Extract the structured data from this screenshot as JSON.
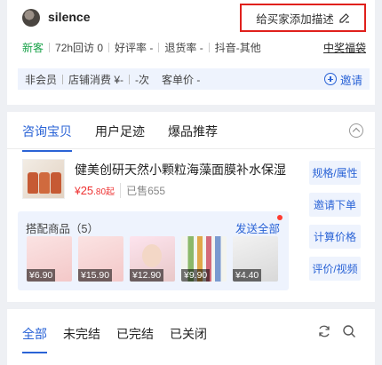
{
  "header": {
    "username": "silence",
    "add_note": "给买家添加描述",
    "stats": [
      "新客",
      "72h回访 0",
      "好评率 -",
      "退货率 -",
      "抖音-其他"
    ],
    "prize_link": "中奖福袋",
    "tags": [
      "非会员",
      "店铺消费 ¥-",
      "-次",
      "客单价 -"
    ],
    "invite": "邀请"
  },
  "consult": {
    "tabs": [
      "咨询宝贝",
      "用户足迹",
      "爆品推荐"
    ],
    "product": {
      "title": "健美创研天然小颗粒海藻面膜补水保湿",
      "price_symbol": "¥",
      "price_int": "25",
      "price_dec": ".80起",
      "sold": "已售655"
    },
    "match": {
      "title": "搭配商品（5）",
      "send_all": "发送全部",
      "items": [
        {
          "price": "¥6.90"
        },
        {
          "price": "¥15.90"
        },
        {
          "price": "¥12.90"
        },
        {
          "price": "¥9.90"
        },
        {
          "price": "¥4.40"
        }
      ]
    },
    "side_buttons": [
      "规格/属性",
      "邀请下单",
      "计算价格",
      "评价/视频"
    ]
  },
  "filters": {
    "tabs": [
      "全部",
      "未完结",
      "已完结",
      "已关闭"
    ]
  },
  "colors": {
    "accent": "#2a63d6",
    "price": "#e33333",
    "new_customer": "#1aa34a",
    "highlight_box": "#e0201c"
  }
}
